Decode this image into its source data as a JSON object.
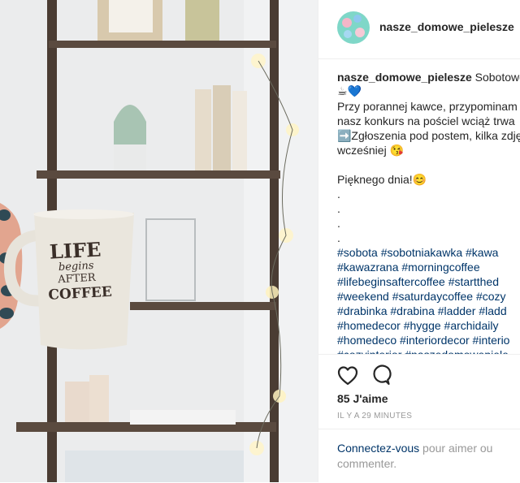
{
  "post": {
    "username": "nasze_domowe_pielesze",
    "image_text": [
      "LIFE",
      "begins",
      "AFTER",
      "COFFEE"
    ]
  },
  "caption": {
    "author": "nasze_domowe_pielesze",
    "first_line": "Sobotowo",
    "emoji_line": "☕💙",
    "lines": [
      "Przy porannej kawce, przypominam",
      "nasz konkurs na pościel wciąż trwa",
      "➡️Zgłoszenia pod postem, kilka zdjęć",
      "wcześniej 😘",
      "",
      "Pięknego dnia!😊",
      ".",
      ".",
      ".",
      "."
    ],
    "hashtag_lines": [
      "#sobota #sobotniakawka #kawa",
      "#kawazrana #morningcoffee",
      "#lifebeginsaftercoffee #startthed",
      "#weekend #saturdaycoffee #cozy",
      "#drabinka #drabina #ladder #ladd",
      "#homedecor #hygge #archidaily",
      "#homedeco #interiordecor #interio",
      "#cozyinterior #naszedomowepiele"
    ]
  },
  "actions": {
    "likes": "85 J'aime",
    "time": "IL Y A 29 MINUTES"
  },
  "login": {
    "link": "Connectez-vous",
    "text": " pour aimer ou commenter."
  }
}
